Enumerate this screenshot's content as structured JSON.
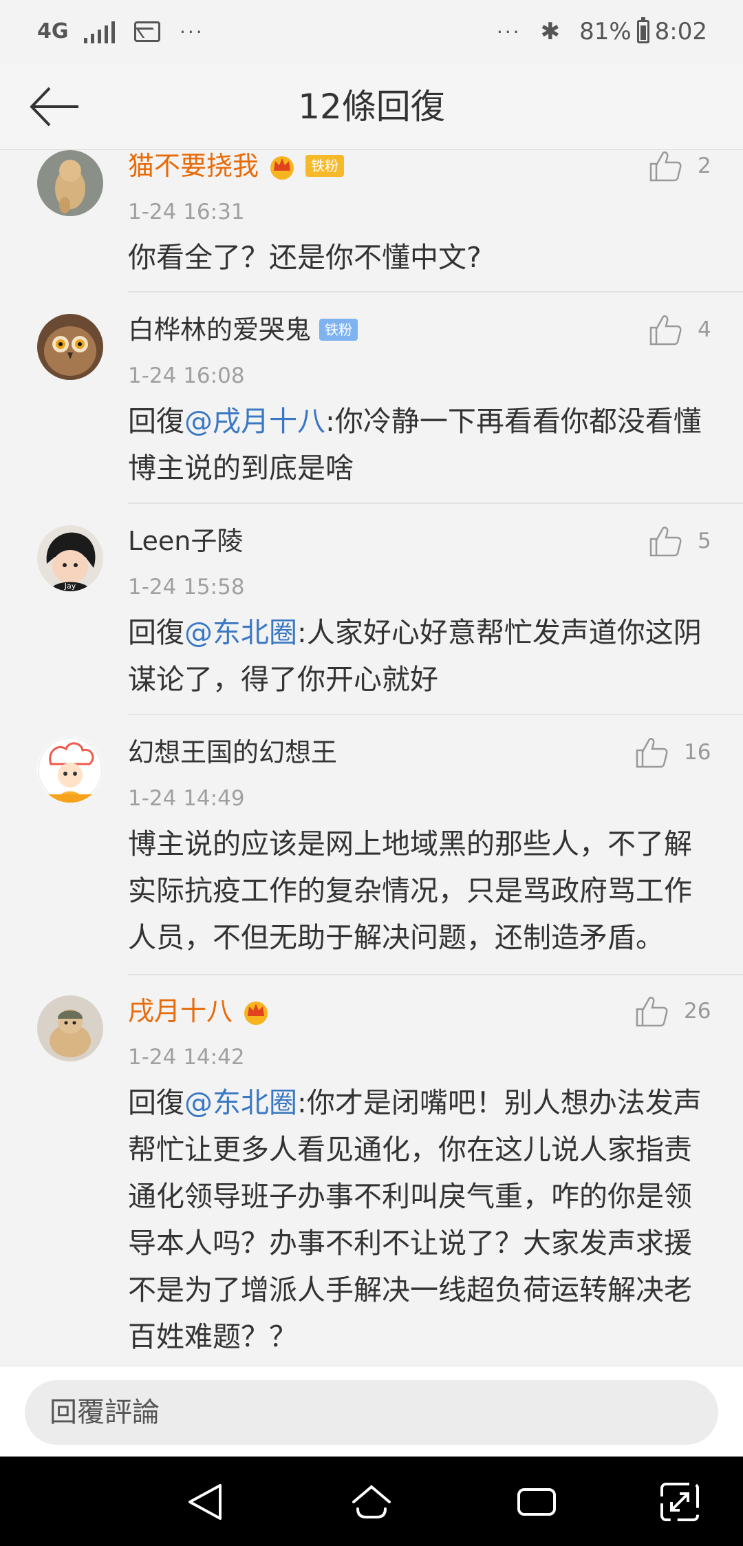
{
  "status_bar": {
    "network": "4G",
    "more_indicator": "···",
    "more_right": "···",
    "battery_percent": "81%",
    "time": "8:02",
    "battery_level": 0.81
  },
  "header": {
    "title": "12條回復"
  },
  "comments": [
    {
      "name": "猫不要挠我",
      "vip": true,
      "badge": "铁粉",
      "time": "1-24 16:31",
      "text": "你看全了？还是你不懂中文?",
      "likes": "2"
    },
    {
      "name": "白桦林的爱哭鬼",
      "vip": false,
      "badge": "铁粉",
      "time": "1-24 16:08",
      "reply_prefix": "回復",
      "mention": "@戌月十八",
      "text": ":你冷静一下再看看你都没看懂博主说的到底是啥",
      "likes": "4"
    },
    {
      "name": "Leen子陵",
      "vip": false,
      "time": "1-24 15:58",
      "reply_prefix": "回復",
      "mention": "@东北圈",
      "text": ":人家好心好意帮忙发声道你这阴谋论了，得了你开心就好",
      "likes": "5",
      "avatar_label": "Jay"
    },
    {
      "name": "幻想王国的幻想王",
      "vip": false,
      "time": "1-24 14:49",
      "text": "博主说的应该是网上地域黑的那些人，不了解实际抗疫工作的复杂情况，只是骂政府骂工作人员，不但无助于解决问题，还制造矛盾。",
      "likes": "16"
    },
    {
      "name": "戌月十八",
      "vip": true,
      "time": "1-24 14:42",
      "reply_prefix": "回復",
      "mention": "@东北圈",
      "text": ":你才是闭嘴吧！别人想办法发声帮忙让更多人看见通化，你在这儿说人家指责通化领导班子办事不利叫戾气重，咋的你是领导本人吗？办事不利不让说了？大家发声求援不是为了增派人手解决一线超负荷运转解决老百姓难题？？",
      "likes": "26"
    }
  ],
  "reply_bar": {
    "placeholder": "回覆評論"
  },
  "colors": {
    "vip_name": "#e86b0a",
    "mention": "#3b78c4",
    "background": "#f3f3f3"
  }
}
